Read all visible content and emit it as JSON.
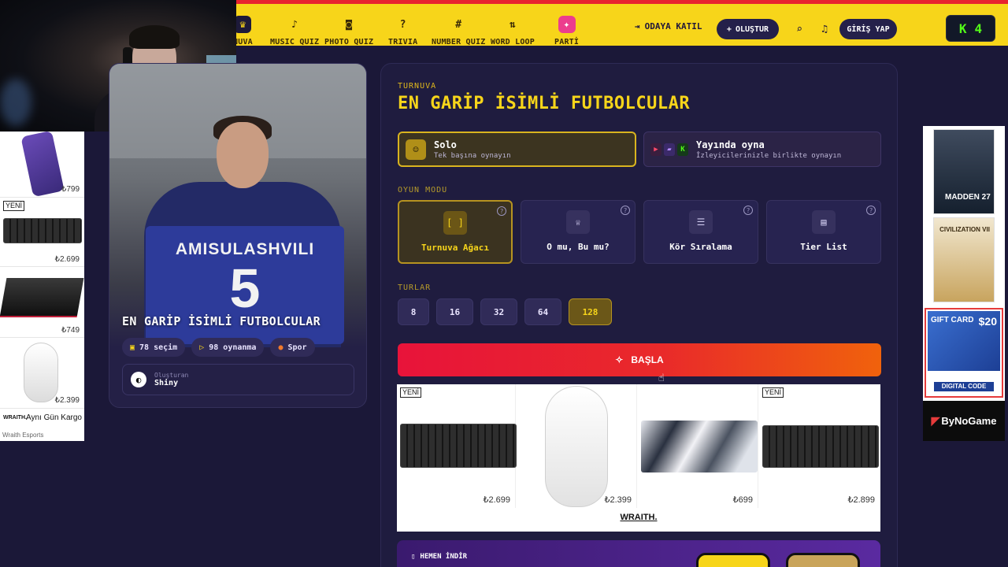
{
  "nav": {
    "items": [
      {
        "label": "NUVA",
        "icon": "trophy-icon",
        "glyph": "♛"
      },
      {
        "label": "MUSIC QUIZ",
        "icon": "music-note-icon",
        "glyph": "♪"
      },
      {
        "label": "PHOTO QUIZ",
        "icon": "camera-icon",
        "glyph": "◙"
      },
      {
        "label": "TRIVIA",
        "icon": "speech-bubble-icon",
        "glyph": "?"
      },
      {
        "label": "NUMBER QUIZ",
        "icon": "hash-icon",
        "glyph": "#"
      },
      {
        "label": "WORD LOOP",
        "icon": "sort-icon",
        "glyph": "⇅"
      },
      {
        "label": "PARTİ",
        "icon": "party-popper-icon",
        "glyph": "✦"
      }
    ],
    "join_label": "ODAYA KATIL",
    "create_label": "OLUŞTUR",
    "login_label": "GİRİŞ YAP",
    "kick_count": "4",
    "kick_letter": "K"
  },
  "left_ad": {
    "prices": [
      "₺799",
      "₺2.699",
      "₺749",
      "₺2.399"
    ],
    "new_badge": "YENİ",
    "brand": "WRAITH.",
    "shipping": "Aynı Gün Kargo",
    "advertiser": "Wraith Esports"
  },
  "hero": {
    "jersey_name": "AMISULASHVILI",
    "jersey_number": "5",
    "title": "EN GARİP İSİMLİ FUTBOLCULAR",
    "stats": {
      "choices": "78 seçim",
      "plays": "98 oynanma",
      "category": "Spor"
    },
    "creator_label": "Oluşturan",
    "creator_name": "Shiny"
  },
  "panel": {
    "kicker": "TURNUVA",
    "title": "EN GARİP İSİMLİ FUTBOLCULAR",
    "modes": [
      {
        "title": "Solo",
        "subtitle": "Tek başına oynayın"
      },
      {
        "title": "Yayında oyna",
        "subtitle": "İzleyicilerinizle birlikte oynayın"
      }
    ],
    "game_mode_label": "OYUN MODU",
    "game_modes": [
      {
        "label": "Turnuva Ağacı",
        "icon": "bracket-icon",
        "glyph": "[ ]"
      },
      {
        "label": "O mu, Bu mu?",
        "icon": "crown-icon",
        "glyph": "♕"
      },
      {
        "label": "Kör Sıralama",
        "icon": "ranked-list-icon",
        "glyph": "☰"
      },
      {
        "label": "Tier List",
        "icon": "tier-list-icon",
        "glyph": "▤"
      }
    ],
    "help_glyph": "?",
    "rounds_label": "TURLAR",
    "rounds": [
      "8",
      "16",
      "32",
      "64",
      "128"
    ],
    "selected_round": "128",
    "start_label": "BAŞLA"
  },
  "bottom_ad": {
    "new_badge": "YENİ",
    "prices": [
      "₺2.699",
      "₺2.399",
      "₺699",
      "₺2.899"
    ],
    "brand": "WRAITH."
  },
  "app_banner": {
    "label": "HEMEN İNDİR"
  },
  "right_ad": {
    "game1": "MADDEN 27",
    "game2": "CIVILIZATION VII",
    "gift_card": "GIFT CARD",
    "gift_amount": "$20",
    "digital_code": "DIGITAL CODE",
    "brand": "ByNoGame"
  },
  "colors": {
    "nav_bg": "#f7d51a",
    "accent_red": "#e8232f",
    "panel_bg": "#1f1c3f",
    "start_from": "#e8133a",
    "start_to": "#f0620c"
  }
}
